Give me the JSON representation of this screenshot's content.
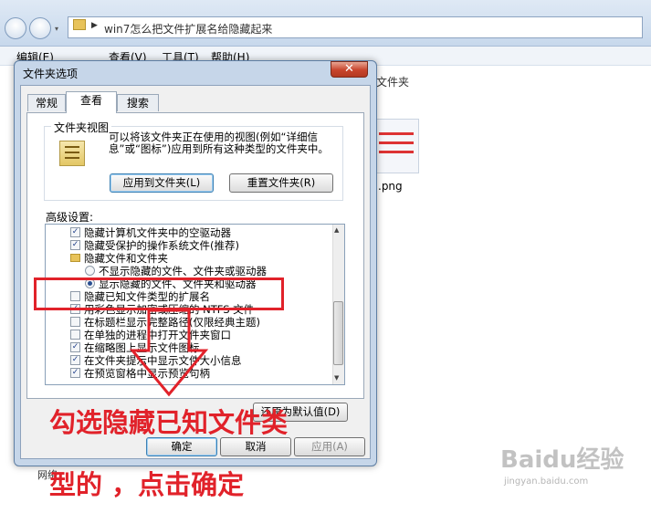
{
  "explorer": {
    "address": "win7怎么把文件扩展名给隐藏起来",
    "menu": [
      "编辑(E)",
      "查看(V)",
      "工具(T)",
      "帮助(H)"
    ],
    "folder_hint": "文件夹",
    "thumbnail_name": ".png",
    "status_item": "网络"
  },
  "dialog": {
    "title": "文件夹选项",
    "close_label": "✕",
    "tabs": [
      "常规",
      "查看",
      "搜索"
    ],
    "folder_view": {
      "group_label": "文件夹视图",
      "description": "可以将该文件夹正在使用的视图(例如“详细信息”或“图标”)应用到所有这种类型的文件夹中。",
      "apply_button": "应用到文件夹(L)",
      "reset_button": "重置文件夹(R)"
    },
    "advanced_label": "高级设置:",
    "advanced_items": [
      {
        "kind": "checkbox",
        "checked": true,
        "label": "隐藏计算机文件夹中的空驱动器"
      },
      {
        "kind": "checkbox",
        "checked": true,
        "label": "隐藏受保护的操作系统文件(推荐)"
      },
      {
        "kind": "folder",
        "label": "隐藏文件和文件夹"
      },
      {
        "kind": "radio",
        "checked": false,
        "label": "不显示隐藏的文件、文件夹或驱动器"
      },
      {
        "kind": "radio",
        "checked": true,
        "label": "显示隐藏的文件、文件夹和驱动器"
      },
      {
        "kind": "checkbox",
        "checked": false,
        "label": "隐藏已知文件类型的扩展名"
      },
      {
        "kind": "checkbox",
        "checked": true,
        "label": "用彩色显示加密或压缩的 NTFS 文件"
      },
      {
        "kind": "checkbox",
        "checked": false,
        "label": "在标题栏显示完整路径(仅限经典主题)"
      },
      {
        "kind": "checkbox",
        "checked": false,
        "label": "在单独的进程中打开文件夹窗口"
      },
      {
        "kind": "checkbox",
        "checked": true,
        "label": "在缩略图上显示文件图标"
      },
      {
        "kind": "checkbox",
        "checked": true,
        "label": "在文件夹提示中显示文件大小信息"
      },
      {
        "kind": "checkbox",
        "checked": true,
        "label": "在预览窗格中显示预览句柄"
      }
    ],
    "restore_button": "还原为默认值(D)",
    "ok_button": "确定",
    "cancel_button": "取消",
    "apply_button": "应用(A)"
  },
  "annotation": {
    "line1": "勾选隐藏已知文件类",
    "line2": "型的 ，点击确定",
    "color": "#e1222a"
  },
  "watermark": {
    "logo": "Baidu经验",
    "url": "jingyan.baidu.com"
  }
}
